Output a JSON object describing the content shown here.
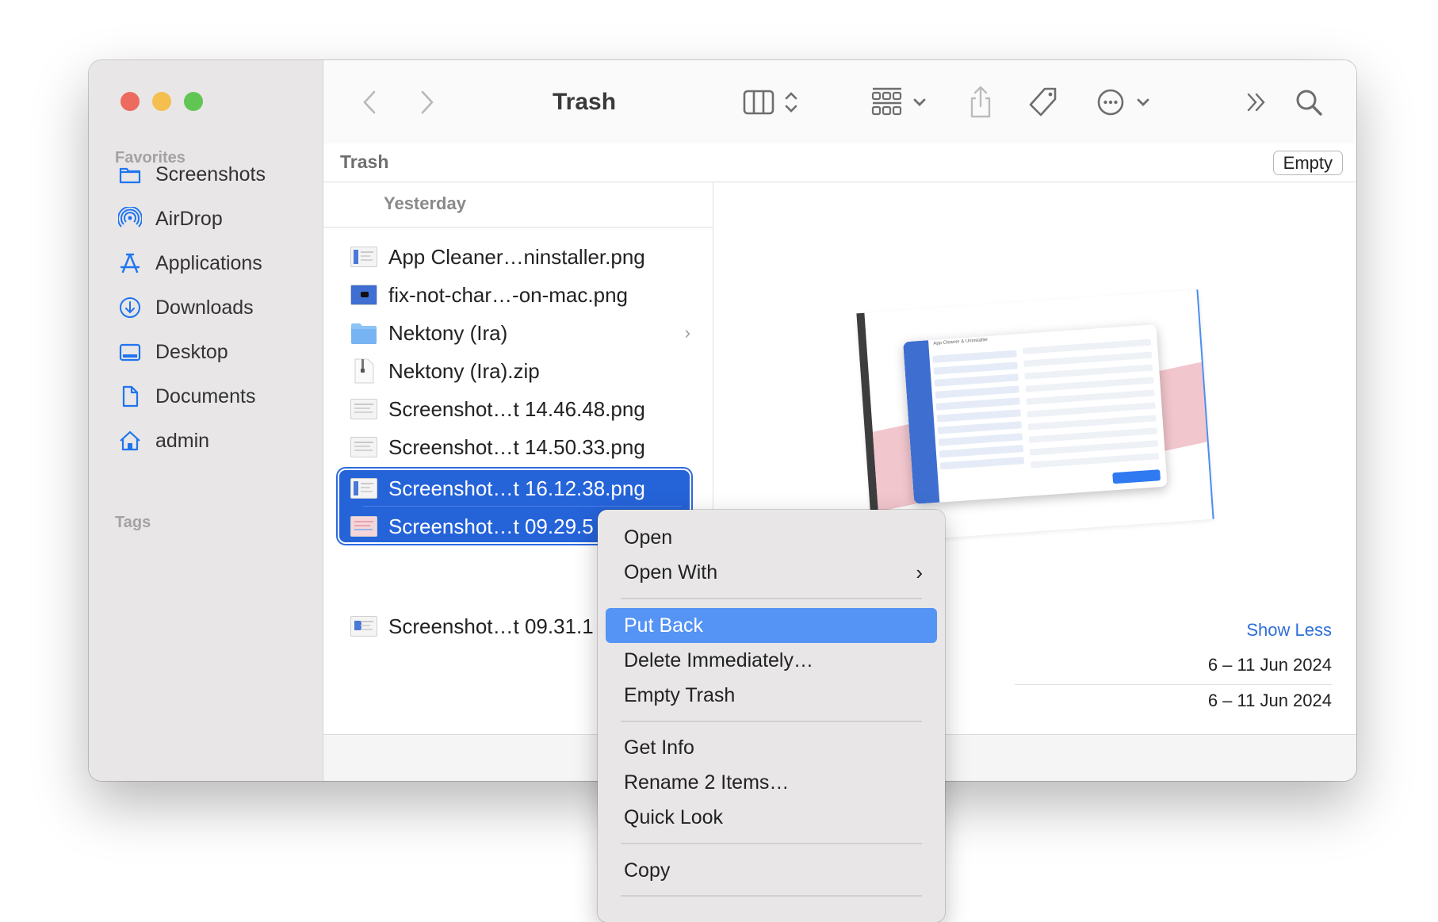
{
  "window": {
    "title": "Trash",
    "traffic_lights": [
      "close",
      "minimize",
      "zoom"
    ]
  },
  "sidebar": {
    "favorites_label": "Favorites",
    "tags_label": "Tags",
    "items": [
      {
        "label": "Screenshots",
        "icon": "folder-icon"
      },
      {
        "label": "AirDrop",
        "icon": "airdrop-icon"
      },
      {
        "label": "Applications",
        "icon": "applications-icon"
      },
      {
        "label": "Downloads",
        "icon": "downloads-icon"
      },
      {
        "label": "Desktop",
        "icon": "desktop-icon"
      },
      {
        "label": "Documents",
        "icon": "document-icon"
      },
      {
        "label": "admin",
        "icon": "home-icon"
      }
    ],
    "icon_color": "#1f74f0"
  },
  "toolbar": {
    "back": "back-icon",
    "forward": "forward-icon",
    "title": "Trash",
    "view_mode": "columns-view-icon",
    "group_by": "group-icon",
    "share": "share-icon",
    "tags": "tag-icon",
    "action": "more-icon",
    "overflow": "overflow-icon",
    "search": "search-icon"
  },
  "pathbar": {
    "label": "Trash",
    "empty_button": "Empty"
  },
  "column": {
    "group_header": "Yesterday",
    "files": [
      {
        "name": "App Cleaner…ninstaller.png",
        "type": "image"
      },
      {
        "name": "fix-not-char…-on-mac.png",
        "type": "image"
      },
      {
        "name": "Nektony (Ira)",
        "type": "folder",
        "has_children": true
      },
      {
        "name": "Nektony (Ira).zip",
        "type": "zip"
      },
      {
        "name": "Screenshot…t 14.46.48.png",
        "type": "image"
      },
      {
        "name": "Screenshot…t 14.50.33.png",
        "type": "image"
      }
    ],
    "selected_files": [
      {
        "name": "Screenshot…t 16.12.38.png",
        "type": "image"
      },
      {
        "name": "Screenshot…t 09.29.5",
        "type": "image"
      }
    ],
    "after_files": [
      {
        "name": "Screenshot…t 09.31.1",
        "type": "image"
      }
    ],
    "selection_color": "#2563d9"
  },
  "preview": {
    "app_title": "App Cleaner & Uninstaller",
    "show_less": "Show Less",
    "dates": [
      "6 – 11 Jun 2024",
      "6 – 11 Jun 2024"
    ]
  },
  "context_menu": {
    "items": [
      {
        "label": "Open"
      },
      {
        "label": "Open With",
        "submenu": true
      },
      {
        "separator": true
      },
      {
        "label": "Put Back",
        "highlighted": true
      },
      {
        "label": "Delete Immediately…"
      },
      {
        "label": "Empty Trash"
      },
      {
        "separator": true
      },
      {
        "label": "Get Info"
      },
      {
        "label": "Rename 2 Items…"
      },
      {
        "label": "Quick Look"
      },
      {
        "separator": true
      },
      {
        "label": "Copy"
      },
      {
        "separator": true
      }
    ],
    "highlight_color": "#5593f5"
  }
}
